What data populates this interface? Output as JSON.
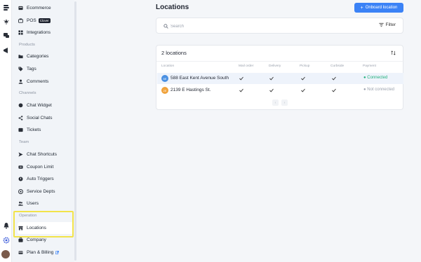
{
  "header": {
    "title": "Locations",
    "onboard_label": "Onboard location"
  },
  "search": {
    "placeholder": "Search",
    "filter_label": "Filter"
  },
  "sidebar": {
    "items_top": [
      {
        "label": "Ecommerce",
        "icon": "ecommerce-icon"
      },
      {
        "label": "POS",
        "badge": "Clover",
        "icon": "pos-icon"
      },
      {
        "label": "Integrations",
        "icon": "integrations-icon"
      }
    ],
    "sections": {
      "products": "Products",
      "channels": "Channels",
      "team": "Team",
      "operation": "Operation"
    },
    "products_items": [
      {
        "label": "Categories",
        "icon": "folder-icon"
      },
      {
        "label": "Tags",
        "icon": "tag-icon"
      },
      {
        "label": "Comments",
        "icon": "comments-icon"
      }
    ],
    "channels_items": [
      {
        "label": "Chat Widget",
        "icon": "chat-icon"
      },
      {
        "label": "Social Chats",
        "icon": "share-icon"
      },
      {
        "label": "Tickets",
        "icon": "ticket-icon"
      }
    ],
    "team_items": [
      {
        "label": "Chat Shortcuts",
        "icon": "send-icon"
      },
      {
        "label": "Coupon Limit",
        "icon": "coupon-icon"
      },
      {
        "label": "Auto Triggers",
        "icon": "trigger-icon"
      },
      {
        "label": "Service Depts",
        "icon": "department-icon"
      },
      {
        "label": "Users",
        "icon": "users-icon"
      }
    ],
    "operation_items": [
      {
        "label": "Locations",
        "icon": "store-icon"
      },
      {
        "label": "Company",
        "icon": "briefcase-icon"
      },
      {
        "label": "Plan & Billing",
        "icon": "billing-icon"
      }
    ]
  },
  "table": {
    "count_label": "2 locations",
    "columns": [
      "Location",
      "Mail order",
      "Delivery",
      "Pickup",
      "Curbside",
      "Payment"
    ],
    "rows": [
      {
        "initials": "5E",
        "name": "588 East Kent Avenue South",
        "avatar_color": "#4a90e2",
        "mail_order": true,
        "delivery": true,
        "pickup": true,
        "curbside": true,
        "payment": "Connected",
        "payment_color": "#22b07d"
      },
      {
        "initials": "2E",
        "name": "2139 E Hastings St.",
        "avatar_color": "#f0a23b",
        "mail_order": true,
        "delivery": true,
        "pickup": true,
        "curbside": true,
        "payment": "Not connected",
        "payment_color": "#9aa1ad"
      }
    ]
  },
  "colors": {
    "accent": "#3b82f6",
    "highlight": "#f2e34a",
    "connected": "#22b07d"
  }
}
